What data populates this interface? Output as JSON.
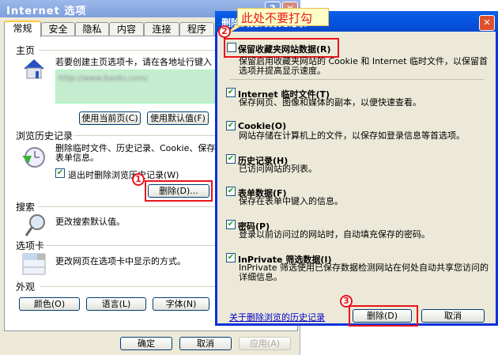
{
  "main_window": {
    "title": "Internet 选项",
    "help": "?",
    "close": "✕",
    "tabs": [
      "常规",
      "安全",
      "隐私",
      "内容",
      "连接",
      "程序"
    ],
    "home": {
      "heading": "主页",
      "desc": "若要创建主页选项卡，请在各地址行键入",
      "url": "http://www.baidu.com/",
      "use_current": "使用当前页(C)",
      "use_default": "使用默认值(F)"
    },
    "history": {
      "heading": "浏览历史记录",
      "desc": "删除临时文件、历史记录、Cookie、保存",
      "desc2": "表单信息。",
      "checkbox": "退出时删除浏览历史记录(W)",
      "delete": "删除(D)..."
    },
    "search": {
      "heading": "搜索",
      "desc": "更改搜索默认值。"
    },
    "tabsec": {
      "heading": "选项卡",
      "desc": "更改网页在选项卡中显示的方式。"
    },
    "appearance": {
      "heading": "外观",
      "colors": "颜色(O)",
      "languages": "语言(L)",
      "fonts": "字体(N)"
    },
    "ok": "确定",
    "cancel": "取消",
    "apply": "应用(A)"
  },
  "dialog": {
    "title": "删除浏览的历史记录",
    "close": "✕",
    "preserve": {
      "label": "保留收藏夹网站数据(R)",
      "desc": "保留启用收藏夹网站的 Cookie 和 Internet 临时文件，以保留首选项并提高显示速度。",
      "checked": false
    },
    "items": [
      {
        "label": "Internet 临时文件(T)",
        "desc": "保存网页、图像和媒体的副本，以便快速查看。",
        "checked": true
      },
      {
        "label": "Cookie(O)",
        "desc": "网站存储在计算机上的文件，以保存如登录信息等首选项。",
        "checked": true
      },
      {
        "label": "历史记录(H)",
        "desc": "已访问网站的列表。",
        "checked": true
      },
      {
        "label": "表单数据(F)",
        "desc": "保存在表单中键入的信息。",
        "checked": true
      },
      {
        "label": "密码(P)",
        "desc": "登录以前访问过的网站时，自动填充保存的密码。",
        "checked": true
      },
      {
        "label": "InPrivate 筛选数据(I)",
        "desc": "InPrivate 筛选使用已保存数据检测网站在何处自动共享您访问的详细信息。",
        "checked": true
      }
    ],
    "link": "关于删除浏览的历史记录",
    "delete": "删除(D)",
    "cancel": "取消"
  },
  "annotations": {
    "callout": "此处不要打勾",
    "step1": "1",
    "step2": "2",
    "step3": "3"
  }
}
